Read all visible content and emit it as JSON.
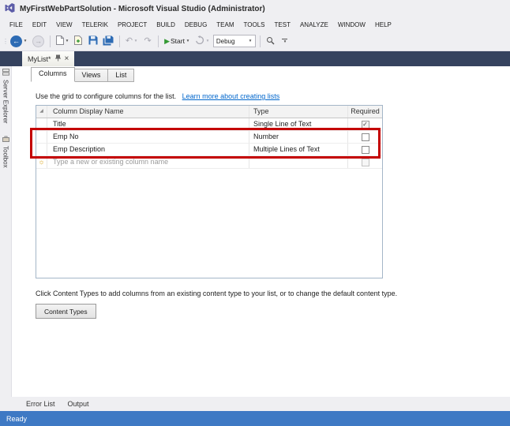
{
  "window": {
    "title": "MyFirstWebPartSolution - Microsoft Visual Studio (Administrator)"
  },
  "menu": {
    "items": [
      "FILE",
      "EDIT",
      "VIEW",
      "TELERIK",
      "PROJECT",
      "BUILD",
      "DEBUG",
      "TEAM",
      "TOOLS",
      "TEST",
      "ANALYZE",
      "WINDOW",
      "HELP"
    ]
  },
  "toolbar": {
    "start_label": "Start",
    "debug_target": "Debug"
  },
  "doc_tab": {
    "label": "MyList*"
  },
  "side_tabs": [
    "Server Explorer",
    "Toolbox"
  ],
  "designer": {
    "tabs": [
      "Columns",
      "Views",
      "List"
    ],
    "active_tab": "Columns",
    "intro_text": "Use the grid to configure columns for the list.",
    "intro_link": "Learn more about creating lists",
    "grid": {
      "headers": [
        "Column Display Name",
        "Type",
        "Required"
      ],
      "rows": [
        {
          "name": "Title",
          "type": "Single Line of Text",
          "required": true
        },
        {
          "name": "Emp No",
          "type": "Number",
          "required": false
        },
        {
          "name": "Emp Description",
          "type": "Multiple Lines of Text",
          "required": false
        }
      ],
      "new_row_placeholder": "Type a new or existing column name"
    },
    "content_types_text": "Click Content Types to add columns from an existing content type to your list, or to change the default content type.",
    "content_types_button": "Content Types"
  },
  "bottom_tabs": [
    "Error List",
    "Output"
  ],
  "status_bar": {
    "text": "Ready"
  },
  "icons": {
    "back": "←",
    "forward": "→",
    "undo": "↶",
    "redo": "↷",
    "play": "▶",
    "caret": "▼",
    "close": "×",
    "check": "✓",
    "new_row": "☼",
    "sort_corner": "◢",
    "drag": "⋮⋮"
  },
  "colors": {
    "accent_red": "#C40000",
    "status_blue": "#3E79C4",
    "tabstrip_navy": "#35425E",
    "link_blue": "#0066CC",
    "start_green": "#349A34",
    "back_blue": "#2D6BB4"
  }
}
